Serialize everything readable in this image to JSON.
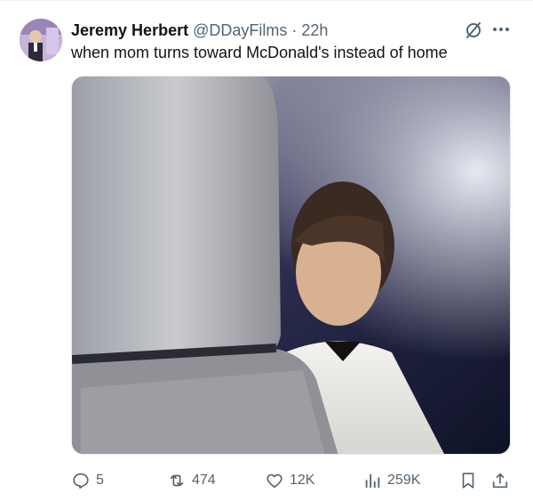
{
  "tweet": {
    "author_name": "Jeremy Herbert",
    "handle": "@DDayFilms",
    "separator": "·",
    "time": "22h",
    "text": "when mom turns toward McDonald's instead of home"
  },
  "actions": {
    "replies": "5",
    "reposts": "474",
    "likes": "12K",
    "views": "259K"
  },
  "icons": {
    "avatar": "avatar",
    "grok": "grok-icon",
    "more": "more-icon",
    "reply": "reply-icon",
    "repost": "repost-icon",
    "like": "like-icon",
    "views": "views-icon",
    "bookmark": "bookmark-icon",
    "share": "share-icon"
  },
  "colors": {
    "text": "#0f1419",
    "muted": "#536471",
    "border": "#eff3f4"
  }
}
